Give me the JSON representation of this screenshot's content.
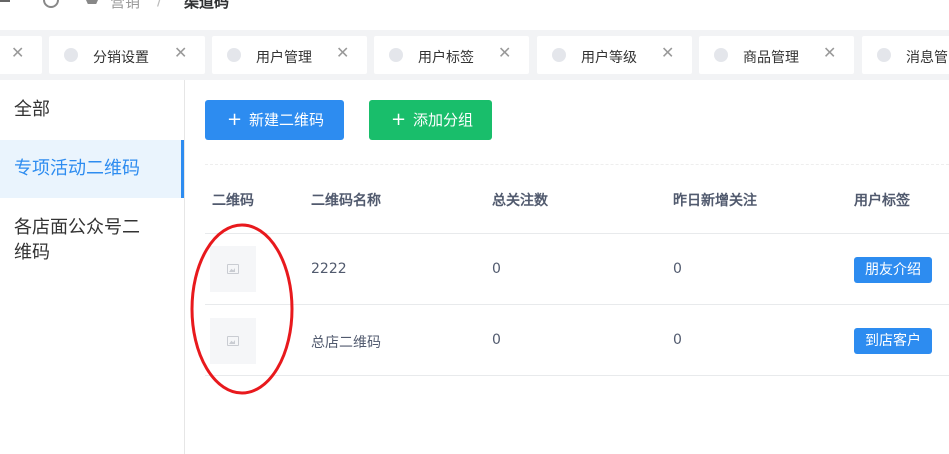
{
  "header": {
    "breadcrumb": [
      "营销",
      "/",
      "渠道码"
    ]
  },
  "tags": [
    {
      "label": ""
    },
    {
      "label": "分销设置"
    },
    {
      "label": "用户管理"
    },
    {
      "label": "用户标签"
    },
    {
      "label": "用户等级"
    },
    {
      "label": "商品管理"
    },
    {
      "label": "消息管"
    }
  ],
  "groups": [
    {
      "label": "全部"
    },
    {
      "label": "专项活动二维码"
    },
    {
      "label": "各店面公众号二维码"
    }
  ],
  "toolbar": {
    "new_qr_label": "新建二维码",
    "add_group_label": "添加分组",
    "plus": "+"
  },
  "table": {
    "headers": [
      "二维码",
      "二维码名称",
      "总关注数",
      "昨日新增关注",
      "用户标签"
    ],
    "rows": [
      {
        "name": "2222",
        "total": "0",
        "yesterday": "0",
        "tag": "朋友介绍"
      },
      {
        "name": "总店二维码",
        "total": "0",
        "yesterday": "0",
        "tag": "到店客户"
      }
    ]
  },
  "colors": {
    "primary": "#2d8cf0",
    "success": "#19be6b",
    "annotation": "#e8191d"
  }
}
